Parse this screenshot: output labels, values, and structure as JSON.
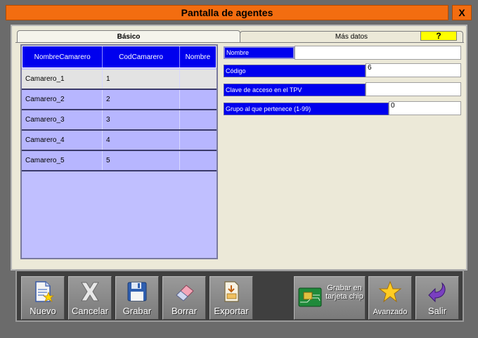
{
  "window": {
    "title": "Pantalla de agentes",
    "close_label": "X"
  },
  "tabs": {
    "basico": "Básico",
    "mas_datos": "Más datos",
    "help": "?"
  },
  "grid": {
    "columns": [
      "NombreCamarero",
      "CodCamarero",
      "Nombre"
    ],
    "rows": [
      {
        "nombre": "Camarero_1",
        "cod": "1",
        "extra": ""
      },
      {
        "nombre": "Camarero_2",
        "cod": "2",
        "extra": ""
      },
      {
        "nombre": "Camarero_3",
        "cod": "3",
        "extra": ""
      },
      {
        "nombre": "Camarero_4",
        "cod": "4",
        "extra": ""
      },
      {
        "nombre": "Camarero_5",
        "cod": "5",
        "extra": ""
      }
    ]
  },
  "fields": {
    "nombre": {
      "label": "Nombre",
      "value": ""
    },
    "codigo": {
      "label": "Código",
      "value": "6"
    },
    "clave": {
      "label": "Clave de acceso en el TPV",
      "value": ""
    },
    "grupo": {
      "label": "Grupo al que pertenece (1-99)",
      "value": "0"
    }
  },
  "toolbar": {
    "nuevo": "Nuevo",
    "cancelar": "Cancelar",
    "grabar": "Grabar",
    "borrar": "Borrar",
    "exportar": "Exportar",
    "chip": "Grabar en tarjeta chip",
    "avanzado": "Avanzado",
    "salir": "Salir"
  },
  "icons": {
    "nuevo": "new-document-icon",
    "cancelar": "cancel-x-icon",
    "grabar": "floppy-disk-icon",
    "borrar": "eraser-icon",
    "exportar": "export-document-icon",
    "chip": "chip-card-icon",
    "avanzado": "star-icon",
    "salir": "exit-arrow-icon"
  },
  "colors": {
    "title_bar": "#f36d10",
    "grid_header": "#0000ee",
    "grid_body": "#c0bfff",
    "help_tab": "#ffff00"
  }
}
